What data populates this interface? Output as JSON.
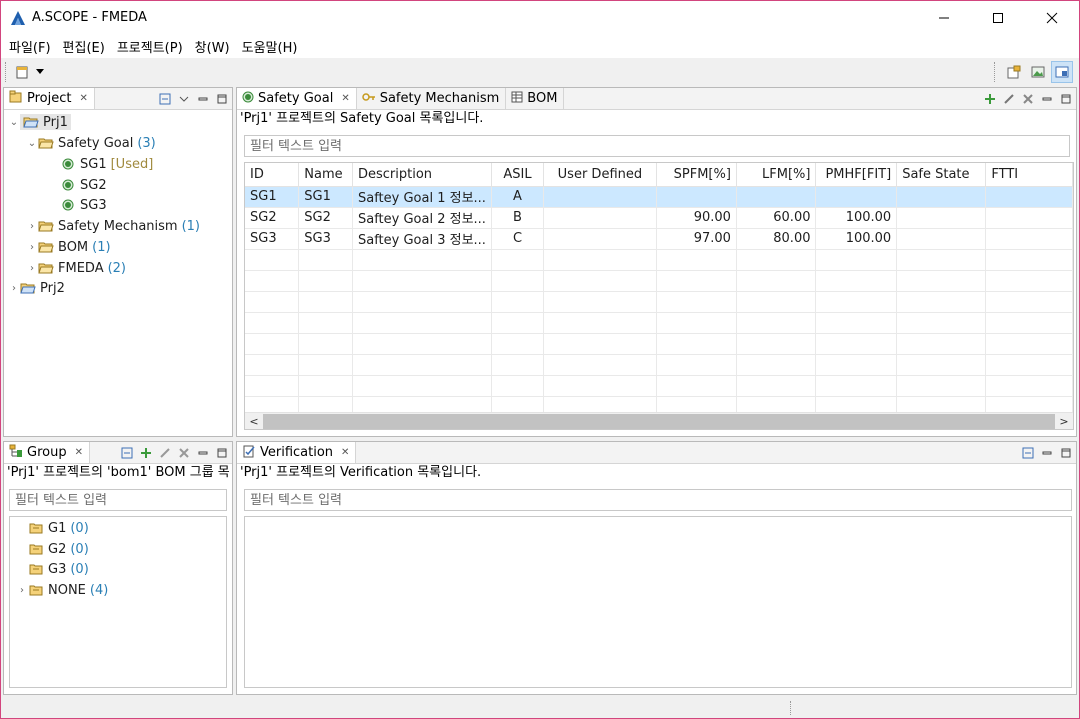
{
  "app": {
    "title": "A.SCOPE - FMEDA",
    "colors": {
      "accent_border": "#d2457e",
      "selection": "#cce8ff",
      "count": "#2a7fb5"
    }
  },
  "menu": [
    "파일(F)",
    "편집(E)",
    "프로젝트(P)",
    "창(W)",
    "도움말(H)"
  ],
  "project_view": {
    "tab": "Project",
    "tree": [
      {
        "label": "Prj1",
        "count": "",
        "extra": "",
        "arrow": "v",
        "icon": "project-folder-open-icon"
      },
      {
        "label": "Safety Goal",
        "count": "(3)",
        "extra": "",
        "arrow": "v",
        "icon": "folder-open-icon"
      },
      {
        "label": "SG1",
        "count": "",
        "extra": "[Used]",
        "arrow": "",
        "icon": "green-dot-icon"
      },
      {
        "label": "SG2",
        "count": "",
        "extra": "",
        "arrow": "",
        "icon": "green-dot-icon"
      },
      {
        "label": "SG3",
        "count": "",
        "extra": "",
        "arrow": "",
        "icon": "green-dot-icon"
      },
      {
        "label": "Safety Mechanism",
        "count": "(1)",
        "extra": "",
        "arrow": ">",
        "icon": "folder-open-icon"
      },
      {
        "label": "BOM",
        "count": "(1)",
        "extra": "",
        "arrow": ">",
        "icon": "folder-open-icon"
      },
      {
        "label": "FMEDA",
        "count": "(2)",
        "extra": "",
        "arrow": ">",
        "icon": "folder-open-icon"
      },
      {
        "label": "Prj2",
        "count": "",
        "extra": "",
        "arrow": ">",
        "icon": "project-folder-open-icon"
      }
    ]
  },
  "editor": {
    "tabs": [
      "Safety Goal",
      "Safety Mechanism",
      "BOM"
    ],
    "subtitle": "'Prj1' 프로젝트의 Safety Goal 목록입니다.",
    "filter_placeholder": "필터 텍스트 입력",
    "columns": [
      "ID",
      "Name",
      "Description",
      "ASIL",
      "User Defined",
      "SPFM[%]",
      "LFM[%]",
      "PMHF[FIT]",
      "Safe State",
      "FTTI"
    ],
    "rows": [
      [
        "SG1",
        "SG1",
        "Saftey Goal 1 정보...",
        "A",
        "",
        "",
        "",
        "",
        "",
        ""
      ],
      [
        "SG2",
        "SG2",
        "Saftey Goal 2 정보...",
        "B",
        "",
        "90.00",
        "60.00",
        "100.00",
        "",
        ""
      ],
      [
        "SG3",
        "SG3",
        "Saftey Goal 3 정보...",
        "C",
        "",
        "97.00",
        "80.00",
        "100.00",
        "",
        ""
      ]
    ],
    "scroll_left": "<",
    "scroll_right": ">"
  },
  "group_view": {
    "tab": "Group",
    "subtitle": "'Prj1' 프로젝트의  'bom1' BOM 그룹 목",
    "filter_placeholder": "필터 텍스트 입력",
    "tree": [
      {
        "label": "G1",
        "count": "(0)",
        "arrow": ""
      },
      {
        "label": "G2",
        "count": "(0)",
        "arrow": ""
      },
      {
        "label": "G3",
        "count": "(0)",
        "arrow": ""
      },
      {
        "label": "NONE",
        "count": "(4)",
        "arrow": ">"
      }
    ]
  },
  "verification_view": {
    "tab": "Verification",
    "subtitle": "'Prj1' 프로젝트의 Verification 목록입니다.",
    "filter_placeholder": "필터 텍스트 입력"
  }
}
